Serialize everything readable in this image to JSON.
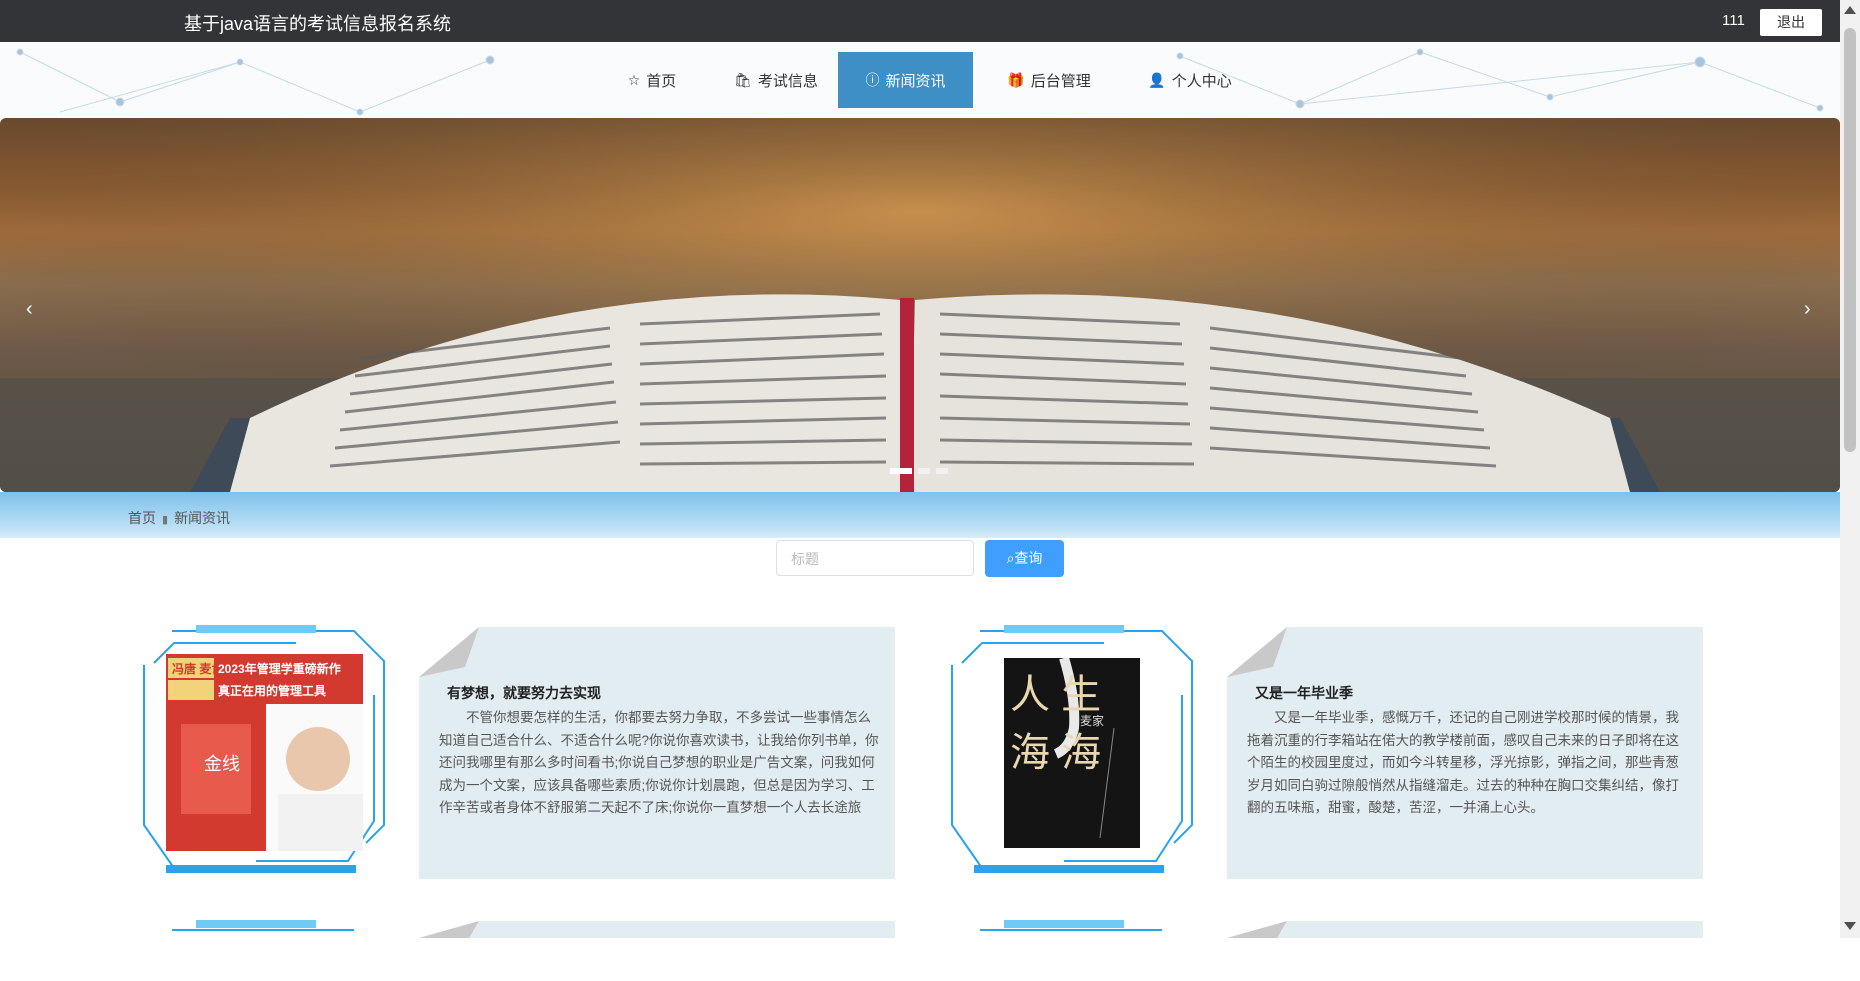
{
  "app": {
    "title": "基于java语言的考试信息报名系统",
    "username": "111",
    "logout_label": "退出"
  },
  "nav": [
    {
      "label": "首页",
      "icon": "star-icon",
      "active": false
    },
    {
      "label": "考试信息",
      "icon": "bag-icon",
      "active": false
    },
    {
      "label": "新闻资讯",
      "icon": "info-circle-icon",
      "active": true
    },
    {
      "label": "后台管理",
      "icon": "gift-icon",
      "active": false
    },
    {
      "label": "个人中心",
      "icon": "user-icon",
      "active": false
    }
  ],
  "breadcrumb": {
    "home": "首页",
    "current": "新闻资讯"
  },
  "search": {
    "placeholder": "标题",
    "button_label": "查询"
  },
  "colors": {
    "topbar": "#333437",
    "nav_active": "#3d8fc6",
    "search_button": "#409eff",
    "card_bg": "#e2edf2"
  },
  "news": [
    {
      "title": "有梦想，就要努力去实现",
      "body": "不管你想要怎样的生活，你都要去努力争取，不多尝试一些事情怎么知道自己适合什么、不适合什么呢?你说你喜欢读书，让我给你列书单，你还问我哪里有那么多时间看书;你说自己梦想的职业是广告文案，问我如何成为一个文案，应该具备哪些素质;你说你计划晨跑，但总是因为学习、工作辛苦或者身体不舒服第二天起不了床;你说你一直梦想一个人去长途旅行，但是没",
      "image": {
        "banner_line1": "2023年管理学重磅新作",
        "banner_line2": "真正在用的管理工具",
        "authors": "冯唐 麦肯锡",
        "book_title": "金线"
      }
    },
    {
      "title": "又是一年毕业季",
      "body": "又是一年毕业季，感慨万千，还记的自己刚进学校那时候的情景，我拖着沉重的行李箱站在偌大的教学楼前面，感叹自己未来的日子即将在这个陌生的校园里度过，而如今斗转星移，浮光掠影，弹指之间，那些青葱岁月如同白驹过隙般悄然从指缝溜走。过去的种种在胸口交集纠结，像打翻的五味瓶，甜蜜，酸楚，苦涩，一并涌上心头。",
      "image": {
        "chars": "人 生 海 海",
        "author": "麦家"
      }
    }
  ]
}
